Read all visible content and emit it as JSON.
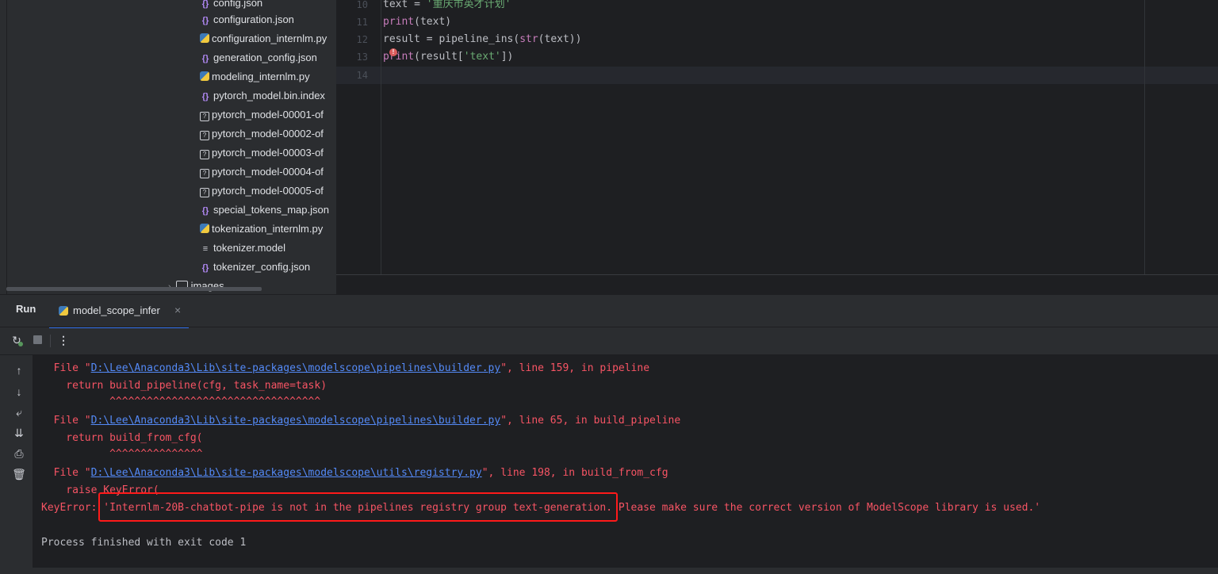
{
  "project_tree": {
    "items": [
      {
        "icon": "json-icon",
        "label": "config.json"
      },
      {
        "icon": "json-icon",
        "label": "configuration.json"
      },
      {
        "icon": "python-file-icon",
        "label": "configuration_internlm.py"
      },
      {
        "icon": "json-icon",
        "label": "generation_config.json"
      },
      {
        "icon": "python-file-icon",
        "label": "modeling_internlm.py"
      },
      {
        "icon": "json-icon",
        "label": "pytorch_model.bin.index"
      },
      {
        "icon": "unknown-file-icon",
        "label": "pytorch_model-00001-of"
      },
      {
        "icon": "unknown-file-icon",
        "label": "pytorch_model-00002-of"
      },
      {
        "icon": "unknown-file-icon",
        "label": "pytorch_model-00003-of"
      },
      {
        "icon": "unknown-file-icon",
        "label": "pytorch_model-00004-of"
      },
      {
        "icon": "unknown-file-icon",
        "label": "pytorch_model-00005-of"
      },
      {
        "icon": "json-icon",
        "label": "special_tokens_map.json"
      },
      {
        "icon": "python-file-icon",
        "label": "tokenization_internlm.py"
      },
      {
        "icon": "text-file-icon",
        "label": "tokenizer.model"
      },
      {
        "icon": "json-icon",
        "label": "tokenizer_config.json"
      }
    ],
    "folder": {
      "icon": "folder-icon",
      "label": "images"
    }
  },
  "editor": {
    "line_numbers": [
      "10",
      "11",
      "12",
      "13",
      "14"
    ],
    "lines": [
      {
        "a": "text = ",
        "b": "'重庆市英才计划'"
      },
      {
        "a": "print",
        "b": "(text)"
      },
      {
        "a": "result = pipeline_ins(",
        "b": "str",
        "c": "(text))"
      },
      {
        "a": "print",
        "b": "(result[",
        "c": "'text'",
        "d": "])"
      },
      {
        "a": ""
      }
    ]
  },
  "run_panel": {
    "title": "Run",
    "tab_label": "model_scope_infer",
    "tab_close": "×",
    "toolbar": {
      "rerun_icon": "rerun-icon",
      "stop_icon": "stop-icon",
      "more": "⋮"
    }
  },
  "console": {
    "lines": [
      {
        "pre": "  File \"",
        "link": "D:\\Lee\\Anaconda3\\Lib\\site-packages\\modelscope\\pipelines\\builder.py",
        "post": "\", line 159, in pipeline"
      },
      {
        "text": "    return build_pipeline(cfg, task_name=task)"
      },
      {
        "text": "           ^^^^^^^^^^^^^^^^^^^^^^^^^^^^^^^^^^"
      },
      {
        "pre": "  File \"",
        "link": "D:\\Lee\\Anaconda3\\Lib\\site-packages\\modelscope\\pipelines\\builder.py",
        "post": "\", line 65, in build_pipeline"
      },
      {
        "text": "    return build_from_cfg("
      },
      {
        "text": "           ^^^^^^^^^^^^^^^"
      },
      {
        "pre": "  File \"",
        "link": "D:\\Lee\\Anaconda3\\Lib\\site-packages\\modelscope\\utils\\registry.py",
        "post": "\", line 198, in build_from_cfg"
      },
      {
        "text": "    raise KeyError("
      },
      {
        "text": "KeyError: 'Internlm-20B-chatbot-pipe is not in the pipelines registry group text-generation. Please make sure the correct version of ModelScope library is used.'"
      },
      {
        "text": ""
      },
      {
        "text": "Process finished with exit code 1"
      }
    ]
  },
  "colors": {
    "error_text": "#f75464",
    "link": "#548af7",
    "highlight_box": "#ff1a1a"
  }
}
